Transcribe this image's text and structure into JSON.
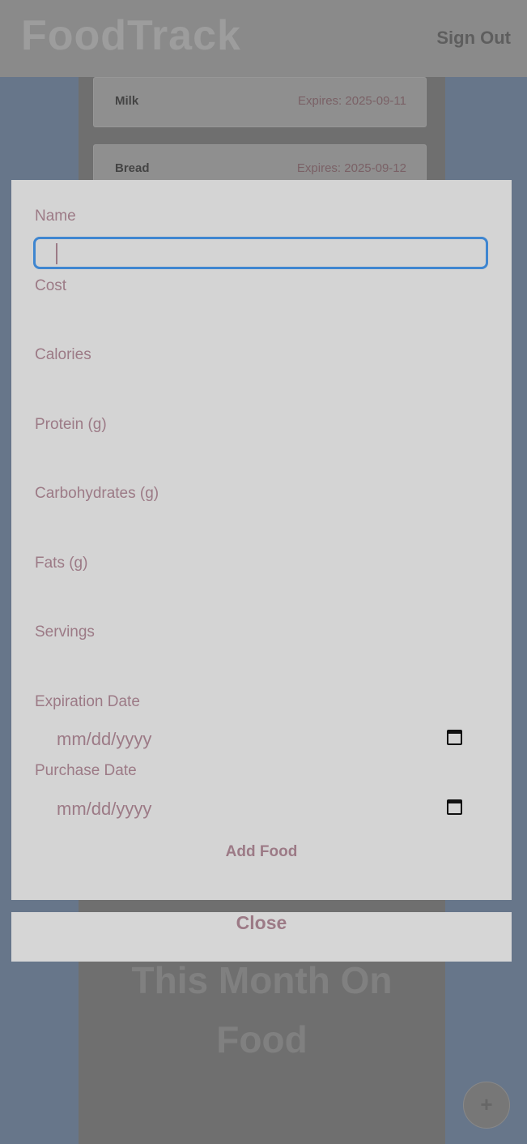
{
  "background": {
    "logo": "FoodTrack",
    "sign_out": "Sign Out",
    "cards": [
      {
        "name": "Milk",
        "expires": "Expires: 2025-09-11"
      },
      {
        "name": "Bread",
        "expires": "Expires: 2025-09-12"
      }
    ],
    "headline_line1": "This Month On",
    "headline_line2": "Food",
    "fab_icon": "plus-icon"
  },
  "form": {
    "fields": {
      "name": "Name",
      "cost": "Cost",
      "calories": "Calories",
      "protein": "Protein (g)",
      "carbohydrates": "Carbohydrates (g)",
      "fats": "Fats (g)",
      "servings": "Servings",
      "expiration_date": "Expiration Date",
      "purchase_date": "Purchase Date"
    },
    "date_placeholder": "mm/dd/yyyy",
    "add_button": "Add Food"
  },
  "close_button": "Close",
  "colors": {
    "label": "#9c7a86",
    "focus_border": "#3f86d0",
    "modal_bg": "#d4d4d4"
  }
}
